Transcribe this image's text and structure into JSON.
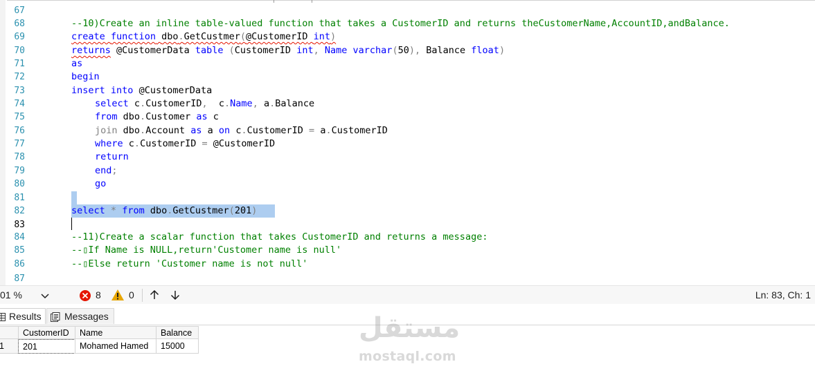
{
  "editor": {
    "lines": [
      {
        "n": "67"
      },
      {
        "n": "68",
        "comment": "--10)Create an inline table-valued function that takes a CustomerID and returns theCustomerName,AccountID,andBalance."
      },
      {
        "n": "69",
        "kw1": "create",
        "kw2": "function",
        "obj": "dbo",
        "fname": "GetCustmer",
        "param": "@CustomerID",
        "ptype": "int"
      },
      {
        "n": "70",
        "kw": "returns",
        "var": "@CustomerData",
        "kwt": "table",
        "c1": "CustomerID",
        "t1": "int",
        "c2": "Name",
        "t2": "varchar",
        "len": "50",
        "c3": "Balance",
        "t3": "float"
      },
      {
        "n": "71",
        "kw": "as"
      },
      {
        "n": "72",
        "kw": "begin"
      },
      {
        "n": "73",
        "kw1": "insert",
        "kw2": "into",
        "var": "@CustomerData"
      },
      {
        "n": "74",
        "kw": "select",
        "p1": "c",
        "f1": "CustomerID",
        "p2": "c",
        "f2": "Name",
        "p3": "a",
        "f3": "Balance"
      },
      {
        "n": "75",
        "kw": "from",
        "obj": "dbo",
        "tbl": "Customer",
        "kwas": "as",
        "alias": "c"
      },
      {
        "n": "76",
        "kwj": "join",
        "obj": "dbo",
        "tbl": "Account",
        "kwas": "as",
        "alias": "a",
        "kwon": "on",
        "p1": "c",
        "f1": "CustomerID",
        "p2": "a",
        "f2": "CustomerID"
      },
      {
        "n": "77",
        "kw": "where",
        "p1": "c",
        "f1": "CustomerID",
        "var": "@CustomerID"
      },
      {
        "n": "78",
        "kw": "return"
      },
      {
        "n": "79",
        "kw": "end"
      },
      {
        "n": "80",
        "kw": "go"
      },
      {
        "n": "81"
      },
      {
        "n": "82",
        "kw1": "select",
        "kw2": "from",
        "obj": "dbo",
        "fname": "GetCustmer",
        "arg": "201"
      },
      {
        "n": "83"
      },
      {
        "n": "84",
        "comment": "--11)Create a scalar function that takes CustomerID and returns a message:"
      },
      {
        "n": "85",
        "comment": "--▯If Name is NULL,return'Customer name is null'"
      },
      {
        "n": "86",
        "comment": "--▯Else return 'Customer name is not null'"
      },
      {
        "n": "87"
      }
    ]
  },
  "status": {
    "zoom": "01 %",
    "errors": "8",
    "warnings": "0",
    "position": "Ln: 83, Ch: 1",
    "error_color": "#e51400",
    "warning_color": "#e8a600"
  },
  "tabs": {
    "results": "Results",
    "messages": "Messages"
  },
  "grid": {
    "columns": [
      "CustomerID",
      "Name",
      "Balance"
    ],
    "rows": [
      {
        "row_num": "1",
        "cells": [
          "201",
          "Mohamed Hamed",
          "15000"
        ]
      }
    ]
  },
  "watermark": {
    "arabic": "مستقل",
    "url": "mostaql.com"
  }
}
